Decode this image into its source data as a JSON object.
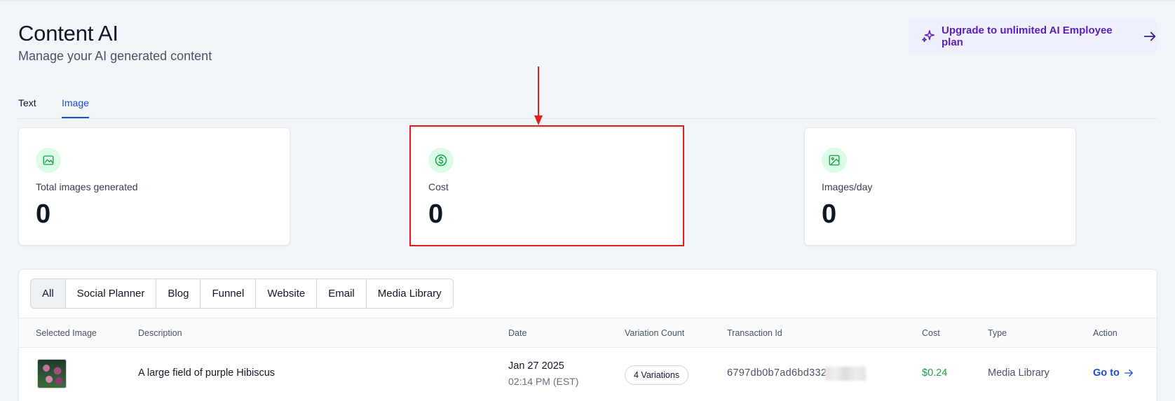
{
  "header": {
    "title": "Content AI",
    "subtitle": "Manage your AI generated content",
    "upgrade_label": "Upgrade to unlimited AI Employee plan"
  },
  "tabs": [
    {
      "label": "Text",
      "active": false
    },
    {
      "label": "Image",
      "active": true
    }
  ],
  "stats": [
    {
      "label": "Total images generated",
      "value": "0",
      "icon": "image-icon"
    },
    {
      "label": "Cost",
      "value": "0",
      "icon": "dollar-icon"
    },
    {
      "label": "Images/day",
      "value": "0",
      "icon": "gallery-icon"
    }
  ],
  "filters": [
    "All",
    "Social Planner",
    "Blog",
    "Funnel",
    "Website",
    "Email",
    "Media Library"
  ],
  "table": {
    "columns": [
      "Selected Image",
      "Description",
      "Date",
      "Variation Count",
      "Transaction Id",
      "Cost",
      "Type",
      "Action"
    ],
    "rows": [
      {
        "description": "A large field of purple Hibiscus",
        "date": "Jan 27 2025",
        "time": "02:14 PM (EST)",
        "variations": "4 Variations",
        "transaction_id": "6797db0b7ad6bd332",
        "cost": "$0.24",
        "type": "Media Library",
        "action": "Go to"
      }
    ]
  },
  "colors": {
    "accent": "#1d4ed8",
    "upgrade": "#5b21b6",
    "success": "#16a34a",
    "highlight": "#e11d1d"
  }
}
